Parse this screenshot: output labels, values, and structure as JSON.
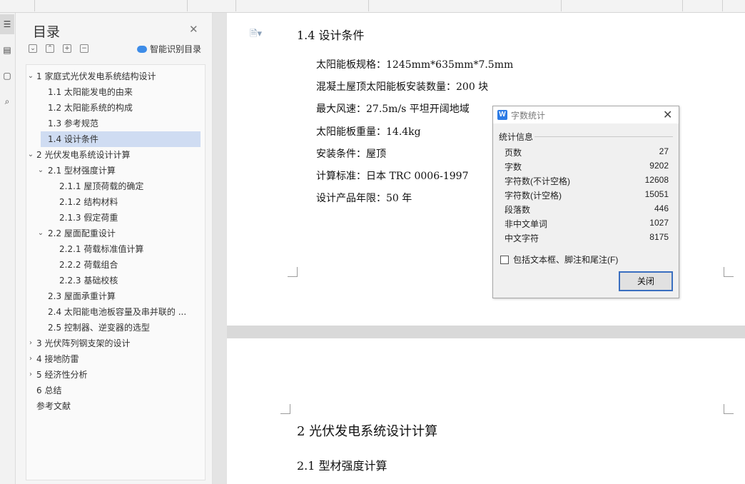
{
  "outline": {
    "title": "目录",
    "close_icon": "close-icon",
    "smart_toc_label": "智能识别目录",
    "tools": [
      "collapse-icon",
      "expand-icon",
      "add-icon",
      "remove-icon"
    ],
    "items": [
      {
        "label": "1  家庭式光伏发电系统结构设计",
        "caret": "down"
      },
      {
        "label": "1.1  太阳能发电的由来",
        "caret": ""
      },
      {
        "label": "1.2  太阳能系统的构成",
        "caret": ""
      },
      {
        "label": "1.3  参考规范",
        "caret": ""
      },
      {
        "label": "1.4  设计条件",
        "caret": "",
        "selected": true
      },
      {
        "label": "2  光伏发电系统设计计算",
        "caret": "down"
      },
      {
        "label": "2.1  型材强度计算",
        "caret": "down"
      },
      {
        "label": "2.1.1  屋顶荷载的确定",
        "caret": ""
      },
      {
        "label": "2.1.2  结构材料",
        "caret": ""
      },
      {
        "label": "2.1.3  假定荷重",
        "caret": ""
      },
      {
        "label": "2.2  屋面配重设计",
        "caret": "down"
      },
      {
        "label": "2.2.1  荷载标准值计算",
        "caret": ""
      },
      {
        "label": "2.2.2  荷载组合",
        "caret": ""
      },
      {
        "label": "2.2.3  基础校核",
        "caret": ""
      },
      {
        "label": "2.3  屋面承重计算",
        "caret": ""
      },
      {
        "label": "2.4  太阳能电池板容量及串并联的 ...",
        "caret": ""
      },
      {
        "label": "2.5  控制器、逆变器的选型",
        "caret": ""
      },
      {
        "label": "3  光伏阵列钢支架的设计",
        "caret": "right"
      },
      {
        "label": "4  接地防雷",
        "caret": "right"
      },
      {
        "label": "5  经济性分析",
        "caret": "right"
      },
      {
        "label": "6  总结",
        "caret": ""
      },
      {
        "label": "参考文献",
        "caret": ""
      }
    ]
  },
  "document": {
    "heading": "1.4  设计条件",
    "paragraphs": [
      "太阳能板规格：1245mm*635mm*7.5mm",
      "混凝土屋顶太阳能板安装数量：200 块",
      "最大风速：27.5m/s    平坦开阔地域",
      "太阳能板重量：14.4kg",
      "安装条件：屋顶",
      "计算标准：日本 TRC 0006-1997",
      "设计产品年限：50 年"
    ],
    "page2_heading": "2  光伏发电系统设计计算",
    "page2_subheading": "2.1  型材强度计算"
  },
  "dialog": {
    "title": "字数统计",
    "group_label": "统计信息",
    "stats": [
      {
        "label": "页数",
        "value": "27"
      },
      {
        "label": "字数",
        "value": "9202"
      },
      {
        "label": "字符数(不计空格)",
        "value": "12608"
      },
      {
        "label": "字符数(计空格)",
        "value": "15051"
      },
      {
        "label": "段落数",
        "value": "446"
      },
      {
        "label": "非中文单词",
        "value": "1027"
      },
      {
        "label": "中文字符",
        "value": "8175"
      }
    ],
    "checkbox_label": "包括文本框、脚注和尾注(F)",
    "checkbox_checked": false,
    "close_button": "关闭"
  },
  "colors": {
    "selected_item": "#cfdcf2",
    "accent": "#2c7be5"
  }
}
